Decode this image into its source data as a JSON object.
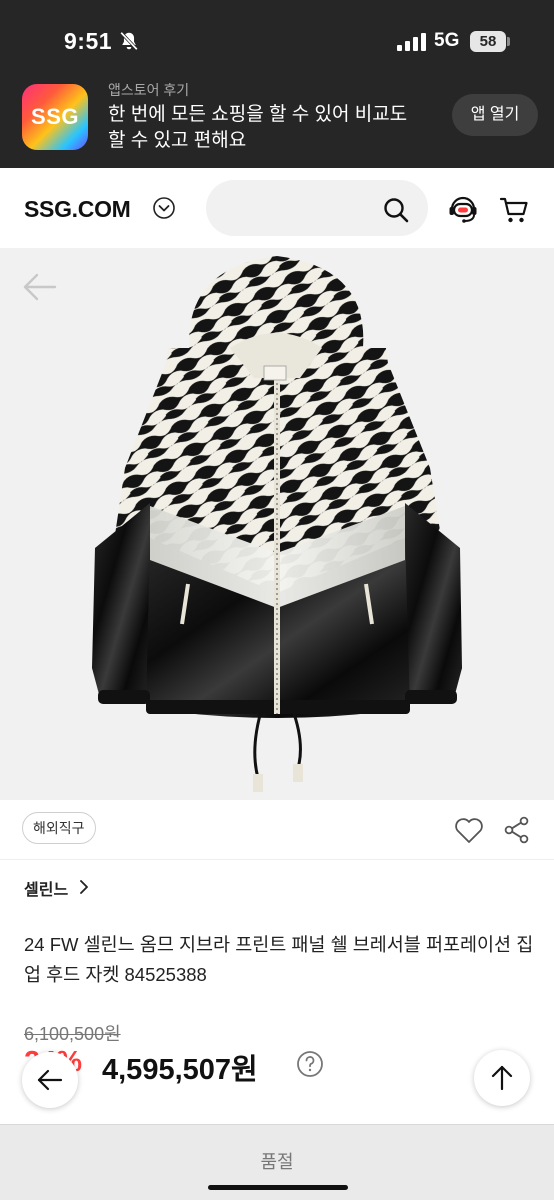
{
  "status_bar": {
    "time": "9:51",
    "network": "5G",
    "battery": "58"
  },
  "app_banner": {
    "logo_text": "SSG",
    "subtitle": "앱스토어 후기",
    "title": "한 번에 모든 쇼핑을 할 수 있어 비교도 할 수 있고 편해요",
    "open_button": "앱 열기"
  },
  "header": {
    "logo": "SSG.COM",
    "search_placeholder": "",
    "icons": [
      "chevron-circle-down-icon",
      "search-icon",
      "support-agent-icon",
      "cart-icon"
    ]
  },
  "product": {
    "image_alt": "Zebra print panel hooded jacket",
    "badge": "해외직구",
    "brand": "셀린느",
    "title": "24 FW 셀린느 옴므 지브라 프린트 패널 쉘 브레서블 퍼포레이션 집업 후드 자켓 84525388",
    "original_price": "6,100,500원",
    "discount": "24%",
    "sale_price": "4,595,507원"
  },
  "footer": {
    "sold_out": "품절"
  },
  "colors": {
    "accent_red": "#ff3d3d",
    "dark_bar": "#262626"
  }
}
